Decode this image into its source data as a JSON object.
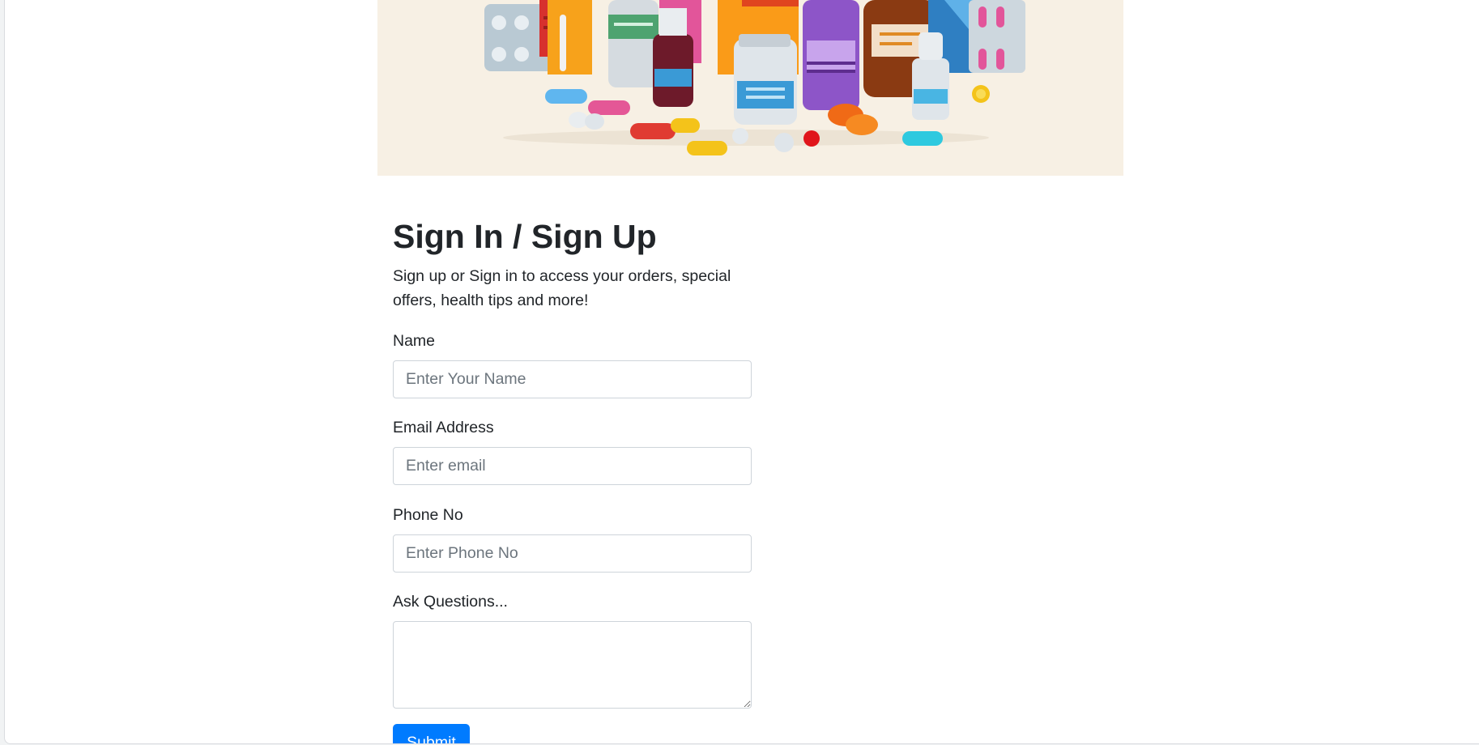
{
  "hero": {
    "illustration": "medicine-bottles-and-pills-illustration",
    "background_color": "#f7f0e4"
  },
  "form": {
    "title": "Sign In / Sign Up",
    "lead": "Sign up or Sign in to access your orders, special offers, health tips and more!",
    "fields": {
      "name": {
        "label": "Name",
        "placeholder": "Enter Your Name",
        "value": ""
      },
      "email": {
        "label": "Email Address",
        "placeholder": "Enter email",
        "value": ""
      },
      "phone": {
        "label": "Phone No",
        "placeholder": "Enter Phone No",
        "value": ""
      },
      "questions": {
        "label": "Ask Questions...",
        "placeholder": "",
        "value": ""
      }
    },
    "submit_label": "Submit",
    "accent_color": "#007bff"
  }
}
